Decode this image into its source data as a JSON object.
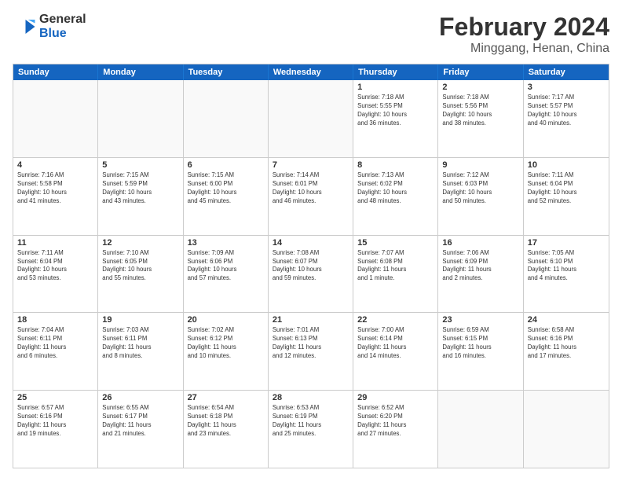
{
  "logo": {
    "line1": "General",
    "line2": "Blue"
  },
  "title": "February 2024",
  "subtitle": "Minggang, Henan, China",
  "header_days": [
    "Sunday",
    "Monday",
    "Tuesday",
    "Wednesday",
    "Thursday",
    "Friday",
    "Saturday"
  ],
  "weeks": [
    [
      {
        "day": "",
        "info": ""
      },
      {
        "day": "",
        "info": ""
      },
      {
        "day": "",
        "info": ""
      },
      {
        "day": "",
        "info": ""
      },
      {
        "day": "1",
        "info": "Sunrise: 7:18 AM\nSunset: 5:55 PM\nDaylight: 10 hours\nand 36 minutes."
      },
      {
        "day": "2",
        "info": "Sunrise: 7:18 AM\nSunset: 5:56 PM\nDaylight: 10 hours\nand 38 minutes."
      },
      {
        "day": "3",
        "info": "Sunrise: 7:17 AM\nSunset: 5:57 PM\nDaylight: 10 hours\nand 40 minutes."
      }
    ],
    [
      {
        "day": "4",
        "info": "Sunrise: 7:16 AM\nSunset: 5:58 PM\nDaylight: 10 hours\nand 41 minutes."
      },
      {
        "day": "5",
        "info": "Sunrise: 7:15 AM\nSunset: 5:59 PM\nDaylight: 10 hours\nand 43 minutes."
      },
      {
        "day": "6",
        "info": "Sunrise: 7:15 AM\nSunset: 6:00 PM\nDaylight: 10 hours\nand 45 minutes."
      },
      {
        "day": "7",
        "info": "Sunrise: 7:14 AM\nSunset: 6:01 PM\nDaylight: 10 hours\nand 46 minutes."
      },
      {
        "day": "8",
        "info": "Sunrise: 7:13 AM\nSunset: 6:02 PM\nDaylight: 10 hours\nand 48 minutes."
      },
      {
        "day": "9",
        "info": "Sunrise: 7:12 AM\nSunset: 6:03 PM\nDaylight: 10 hours\nand 50 minutes."
      },
      {
        "day": "10",
        "info": "Sunrise: 7:11 AM\nSunset: 6:04 PM\nDaylight: 10 hours\nand 52 minutes."
      }
    ],
    [
      {
        "day": "11",
        "info": "Sunrise: 7:11 AM\nSunset: 6:04 PM\nDaylight: 10 hours\nand 53 minutes."
      },
      {
        "day": "12",
        "info": "Sunrise: 7:10 AM\nSunset: 6:05 PM\nDaylight: 10 hours\nand 55 minutes."
      },
      {
        "day": "13",
        "info": "Sunrise: 7:09 AM\nSunset: 6:06 PM\nDaylight: 10 hours\nand 57 minutes."
      },
      {
        "day": "14",
        "info": "Sunrise: 7:08 AM\nSunset: 6:07 PM\nDaylight: 10 hours\nand 59 minutes."
      },
      {
        "day": "15",
        "info": "Sunrise: 7:07 AM\nSunset: 6:08 PM\nDaylight: 11 hours\nand 1 minute."
      },
      {
        "day": "16",
        "info": "Sunrise: 7:06 AM\nSunset: 6:09 PM\nDaylight: 11 hours\nand 2 minutes."
      },
      {
        "day": "17",
        "info": "Sunrise: 7:05 AM\nSunset: 6:10 PM\nDaylight: 11 hours\nand 4 minutes."
      }
    ],
    [
      {
        "day": "18",
        "info": "Sunrise: 7:04 AM\nSunset: 6:11 PM\nDaylight: 11 hours\nand 6 minutes."
      },
      {
        "day": "19",
        "info": "Sunrise: 7:03 AM\nSunset: 6:11 PM\nDaylight: 11 hours\nand 8 minutes."
      },
      {
        "day": "20",
        "info": "Sunrise: 7:02 AM\nSunset: 6:12 PM\nDaylight: 11 hours\nand 10 minutes."
      },
      {
        "day": "21",
        "info": "Sunrise: 7:01 AM\nSunset: 6:13 PM\nDaylight: 11 hours\nand 12 minutes."
      },
      {
        "day": "22",
        "info": "Sunrise: 7:00 AM\nSunset: 6:14 PM\nDaylight: 11 hours\nand 14 minutes."
      },
      {
        "day": "23",
        "info": "Sunrise: 6:59 AM\nSunset: 6:15 PM\nDaylight: 11 hours\nand 16 minutes."
      },
      {
        "day": "24",
        "info": "Sunrise: 6:58 AM\nSunset: 6:16 PM\nDaylight: 11 hours\nand 17 minutes."
      }
    ],
    [
      {
        "day": "25",
        "info": "Sunrise: 6:57 AM\nSunset: 6:16 PM\nDaylight: 11 hours\nand 19 minutes."
      },
      {
        "day": "26",
        "info": "Sunrise: 6:55 AM\nSunset: 6:17 PM\nDaylight: 11 hours\nand 21 minutes."
      },
      {
        "day": "27",
        "info": "Sunrise: 6:54 AM\nSunset: 6:18 PM\nDaylight: 11 hours\nand 23 minutes."
      },
      {
        "day": "28",
        "info": "Sunrise: 6:53 AM\nSunset: 6:19 PM\nDaylight: 11 hours\nand 25 minutes."
      },
      {
        "day": "29",
        "info": "Sunrise: 6:52 AM\nSunset: 6:20 PM\nDaylight: 11 hours\nand 27 minutes."
      },
      {
        "day": "",
        "info": ""
      },
      {
        "day": "",
        "info": ""
      }
    ]
  ]
}
